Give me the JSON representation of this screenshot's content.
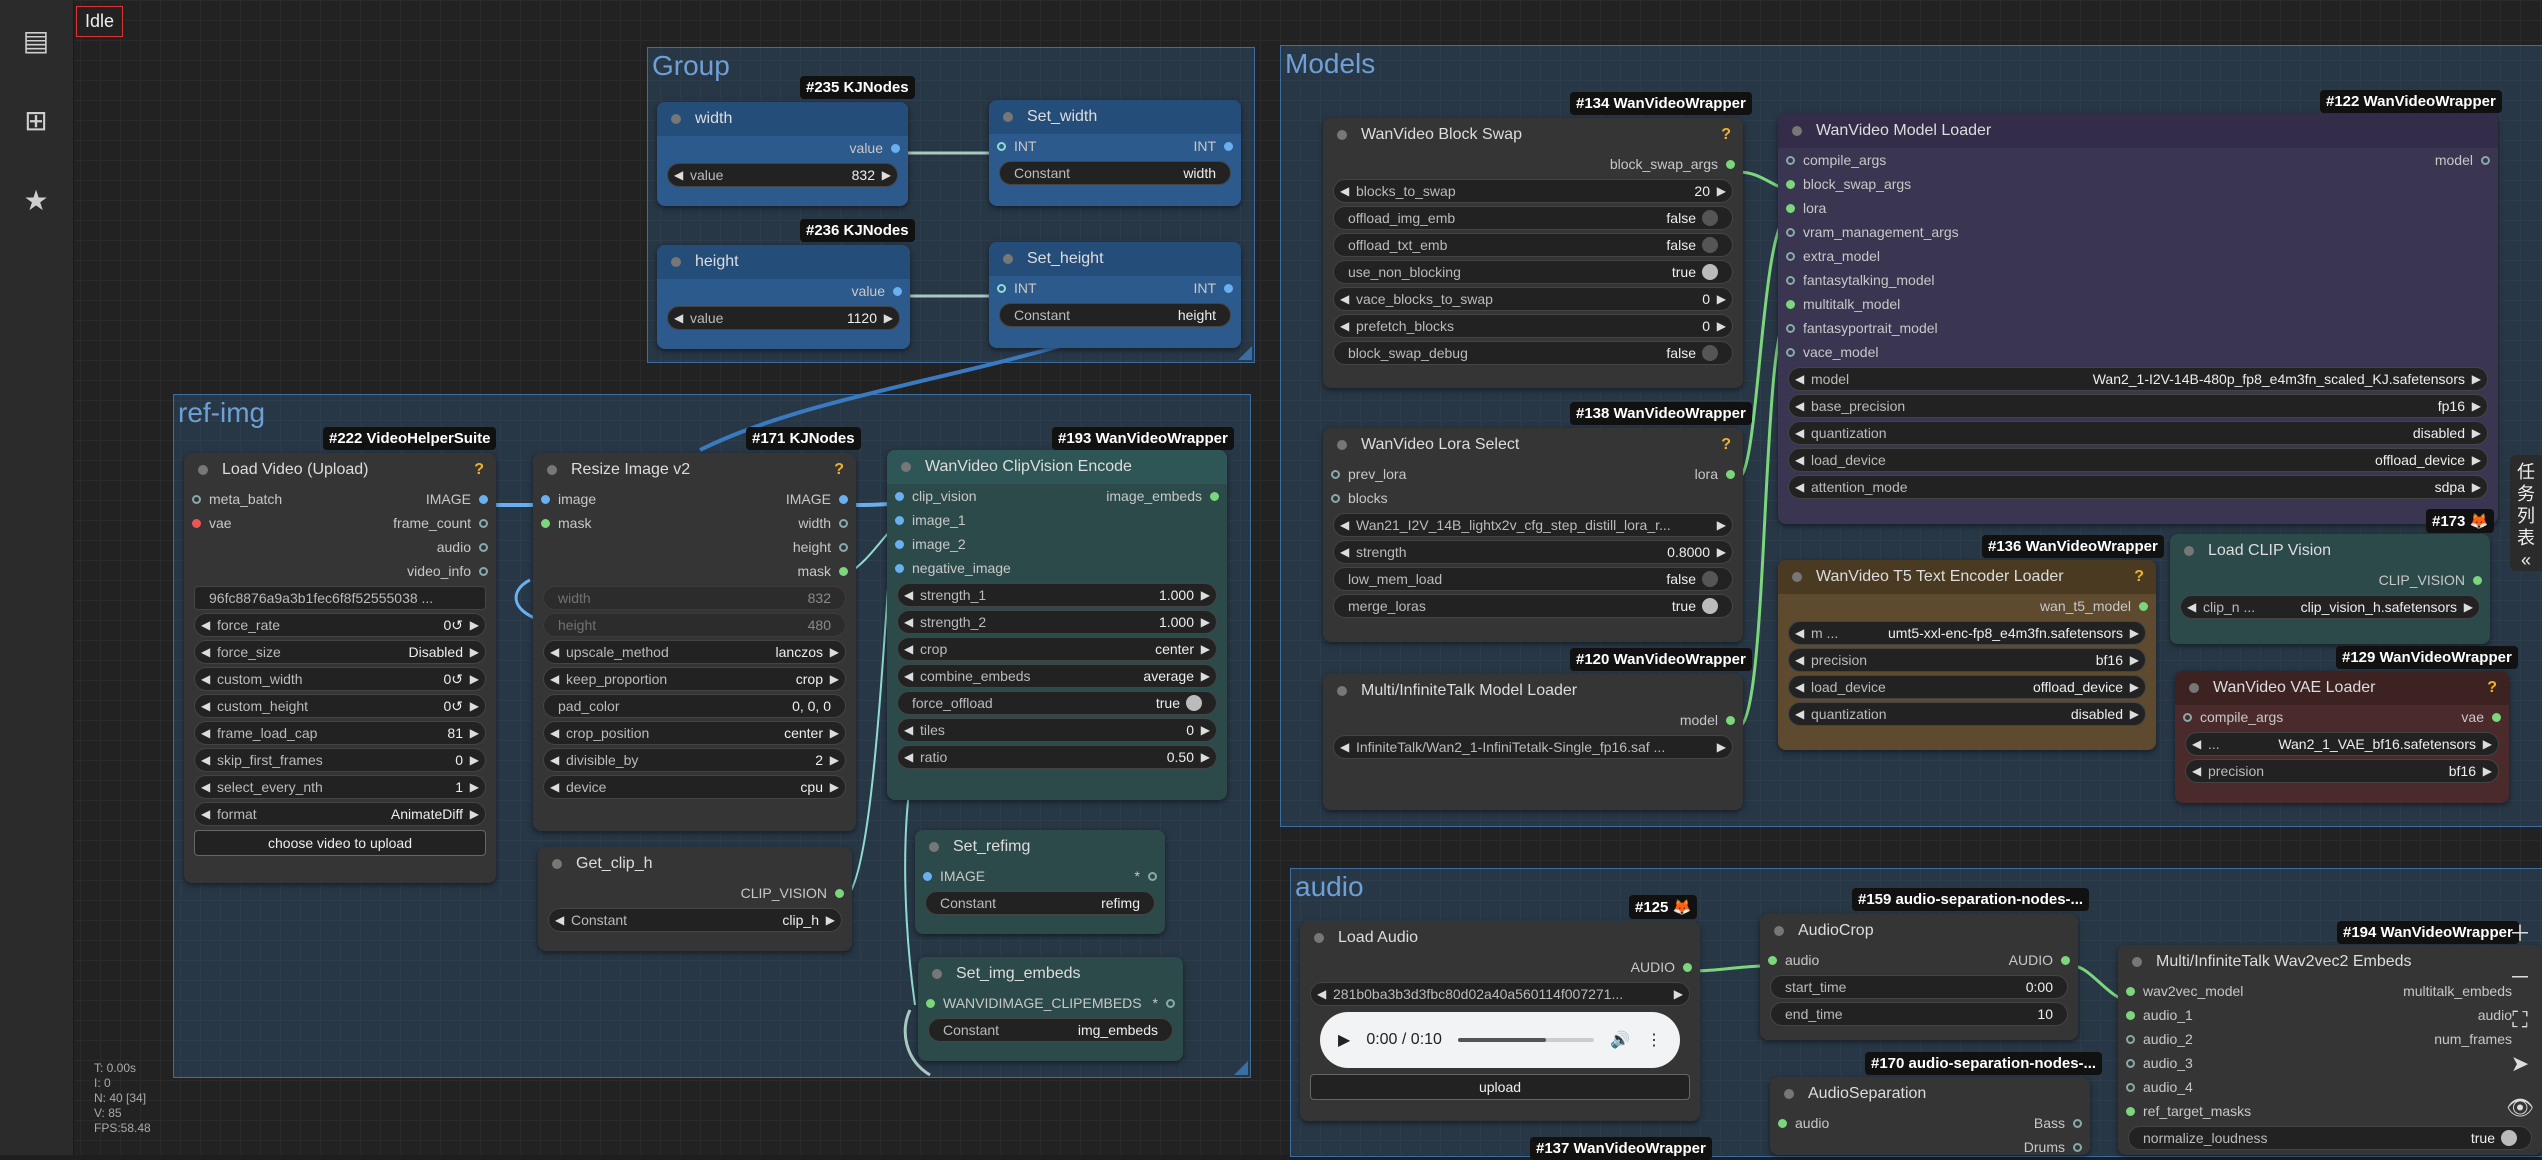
{
  "status": "Idle",
  "sidebar": {
    "icons": [
      "document-icon",
      "node-library-icon",
      "star-icon"
    ]
  },
  "stats": {
    "lines": [
      "T: 0.00s",
      "I: 0",
      "N: 40 [34]",
      "V: 85",
      "FPS:58.48"
    ]
  },
  "taskbar": {
    "chars": [
      "任",
      "务",
      "列",
      "表",
      "«"
    ]
  },
  "groups": {
    "group": "Group",
    "models": "Models",
    "refimg": "ref-img",
    "audio": "audio"
  },
  "nodes": {
    "width": {
      "badge": "#235 KJNodes",
      "title": "width",
      "out": "value",
      "w_label": "value",
      "w_value": "832"
    },
    "height": {
      "badge": "#236 KJNodes",
      "title": "height",
      "out": "value",
      "w_label": "value",
      "w_value": "1120"
    },
    "set_width": {
      "title": "Set_width",
      "in": "INT",
      "out": "INT",
      "w_label": "Constant",
      "w_value": "width"
    },
    "set_height": {
      "title": "Set_height",
      "in": "INT",
      "out": "INT",
      "w_label": "Constant",
      "w_value": "height"
    },
    "load_video": {
      "badge": "#222 VideoHelperSuite",
      "title": "Load Video (Upload)",
      "q": "?",
      "in1": "meta_batch",
      "in2": "vae",
      "out1": "IMAGE",
      "out2": "frame_count",
      "out3": "audio",
      "out4": "video_info",
      "file": "96fc8876a9a3b1fec6f8f52555038 ...",
      "widgets": [
        [
          "force_rate",
          "0↺"
        ],
        [
          "force_size",
          "Disabled"
        ],
        [
          "custom_width",
          "0↺"
        ],
        [
          "custom_height",
          "0↺"
        ],
        [
          "frame_load_cap",
          "81"
        ],
        [
          "skip_first_frames",
          "0"
        ],
        [
          "select_every_nth",
          "1"
        ],
        [
          "format",
          "AnimateDiff"
        ]
      ],
      "button": "choose video to upload"
    },
    "resize": {
      "badge": "#171 KJNodes",
      "title": "Resize Image v2",
      "q": "?",
      "in1": "image",
      "in2": "mask",
      "out1": "IMAGE",
      "out2": "width",
      "out3": "height",
      "out4": "mask",
      "dis": [
        [
          "width",
          "832"
        ],
        [
          "height",
          "480"
        ]
      ],
      "widgets": [
        [
          "upscale_method",
          "lanczos"
        ],
        [
          "keep_proportion",
          "crop"
        ],
        [
          "pad_color",
          "0, 0, 0"
        ],
        [
          "crop_position",
          "center"
        ],
        [
          "divisible_by",
          "2"
        ],
        [
          "device",
          "cpu"
        ]
      ]
    },
    "clipvision": {
      "badge": "#193 WanVideoWrapper",
      "title": "WanVideo ClipVision Encode",
      "ins": [
        "clip_vision",
        "image_1",
        "image_2",
        "negative_image"
      ],
      "out": "image_embeds",
      "widgets": [
        [
          "strength_1",
          "1.000"
        ],
        [
          "strength_2",
          "1.000"
        ],
        [
          "crop",
          "center"
        ],
        [
          "combine_embeds",
          "average"
        ],
        [
          "force_offload",
          "true"
        ],
        [
          "tiles",
          "0"
        ],
        [
          "ratio",
          "0.50"
        ]
      ]
    },
    "get_clip": {
      "title": "Get_clip_h",
      "out": "CLIP_VISION",
      "w_label": "Constant",
      "w_value": "clip_h"
    },
    "set_refimg": {
      "title": "Set_refimg",
      "in": "IMAGE",
      "out": "*",
      "w_label": "Constant",
      "w_value": "refimg"
    },
    "set_img_embeds": {
      "title": "Set_img_embeds",
      "in": "WANVIDIMAGE_CLIPEMBEDS",
      "out": "*",
      "w_label": "Constant",
      "w_value": "img_embeds"
    },
    "block_swap": {
      "badge": "#134 WanVideoWrapper",
      "title": "WanVideo Block Swap",
      "q": "?",
      "out": "block_swap_args",
      "widgets": [
        [
          "blocks_to_swap",
          "20"
        ],
        [
          "offload_img_emb",
          "false"
        ],
        [
          "offload_txt_emb",
          "false"
        ],
        [
          "use_non_blocking",
          "true"
        ],
        [
          "vace_blocks_to_swap",
          "0"
        ],
        [
          "prefetch_blocks",
          "0"
        ],
        [
          "block_swap_debug",
          "false"
        ]
      ]
    },
    "lora_select": {
      "badge": "#138 WanVideoWrapper",
      "title": "WanVideo Lora Select",
      "q": "?",
      "in1": "prev_lora",
      "in2": "blocks",
      "out": "lora",
      "lora_file": "Wan21_I2V_14B_lightx2v_cfg_step_distill_lora_r...",
      "widgets": [
        [
          "strength",
          "0.8000"
        ],
        [
          "low_mem_load",
          "false"
        ],
        [
          "merge_loras",
          "true"
        ]
      ]
    },
    "infinitetalk_loader": {
      "badge": "#120 WanVideoWrapper",
      "title": "Multi/InfiniteTalk Model Loader",
      "out": "model",
      "file": "InfiniteTalk/Wan2_1-InfiniTetalk-Single_fp16.saf ..."
    },
    "model_loader": {
      "badge": "#122 WanVideoWrapper",
      "title": "WanVideo Model Loader",
      "out": "model",
      "ins": [
        "compile_args",
        "block_swap_args",
        "lora",
        "vram_management_args",
        "extra_model",
        "fantasytalking_model",
        "multitalk_model",
        "fantasyportrait_model",
        "vace_model"
      ],
      "widgets": [
        [
          "model",
          "Wan2_1-I2V-14B-480p_fp8_e4m3fn_scaled_KJ.safetensors"
        ],
        [
          "base_precision",
          "fp16"
        ],
        [
          "quantization",
          "disabled"
        ],
        [
          "load_device",
          "offload_device"
        ],
        [
          "attention_mode",
          "sdpa"
        ]
      ]
    },
    "t5_loader": {
      "badge": "#136 WanVideoWrapper",
      "title": "WanVideo T5 Text Encoder Loader",
      "q": "?",
      "out": "wan_t5_model",
      "widgets": [
        [
          "m ...",
          "umt5-xxl-enc-fp8_e4m3fn.safetensors"
        ],
        [
          "precision",
          "bf16"
        ],
        [
          "load_device",
          "offload_device"
        ],
        [
          "quantization",
          "disabled"
        ]
      ]
    },
    "clip_loader": {
      "badge": "#173 🦊",
      "title": "Load CLIP Vision",
      "out": "CLIP_VISION",
      "w_label": "clip_n ...",
      "w_value": "clip_vision_h.safetensors"
    },
    "vae_loader": {
      "badge": "#129 WanVideoWrapper",
      "title": "WanVideo VAE Loader",
      "q": "?",
      "in": "compile_args",
      "out": "vae",
      "widgets": [
        [
          "...",
          "Wan2_1_VAE_bf16.safetensors"
        ],
        [
          "precision",
          "bf16"
        ]
      ]
    },
    "load_audio": {
      "badge": "#125 🦊",
      "title": "Load Audio",
      "out": "AUDIO",
      "file": "281b0ba3b3d3fbc80d02a40a560114f007271...",
      "time": "0:00 / 0:10",
      "button": "upload"
    },
    "audio_crop": {
      "badge": "#159 audio-separation-nodes-...",
      "title": "AudioCrop",
      "in": "audio",
      "out": "AUDIO",
      "widgets": [
        [
          "start_time",
          "0:00"
        ],
        [
          "end_time",
          "10"
        ]
      ]
    },
    "audio_sep": {
      "badge": "#170 audio-separation-nodes-...",
      "title": "AudioSeparation",
      "in": "audio",
      "out": "Bass",
      "out2": "Drums"
    },
    "wav2vec": {
      "badge": "#194 WanVideoWrapper",
      "title": "Multi/InfiniteTalk Wav2vec2 Embeds",
      "ins": [
        "wav2vec_model",
        "audio_1",
        "audio_2",
        "audio_3",
        "audio_4",
        "ref_target_masks"
      ],
      "outs": [
        "multitalk_embeds",
        "audio",
        "num_frames"
      ],
      "widget": [
        "normalize_loudness",
        "true"
      ]
    },
    "bottom_badge": {
      "badge": "#137 WanVideoWrapper"
    }
  },
  "player": {
    "progress": 0.65
  }
}
